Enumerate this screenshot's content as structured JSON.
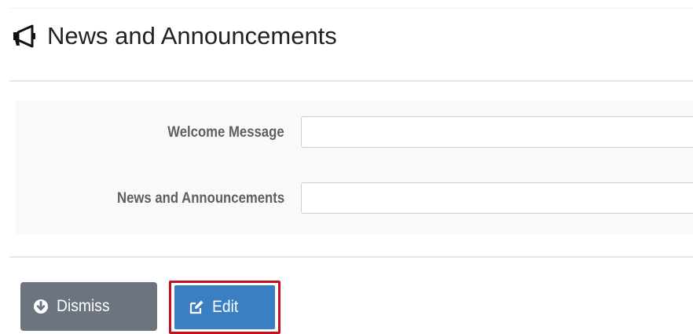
{
  "header": {
    "title": "News and Announcements",
    "icon": "bullhorn-icon"
  },
  "form": {
    "fields": [
      {
        "label": "Welcome Message",
        "value": "",
        "placeholder": ""
      },
      {
        "label": "News and Announcements",
        "value": "",
        "placeholder": ""
      }
    ]
  },
  "actions": {
    "dismiss_label": "Dismiss",
    "dismiss_icon": "arrow-circle-down-icon",
    "edit_label": "Edit",
    "edit_icon": "edit-square-icon"
  },
  "colors": {
    "dismiss_bg": "#6c7480",
    "edit_bg": "#3a7fc1",
    "highlight_border": "#c0131f"
  }
}
